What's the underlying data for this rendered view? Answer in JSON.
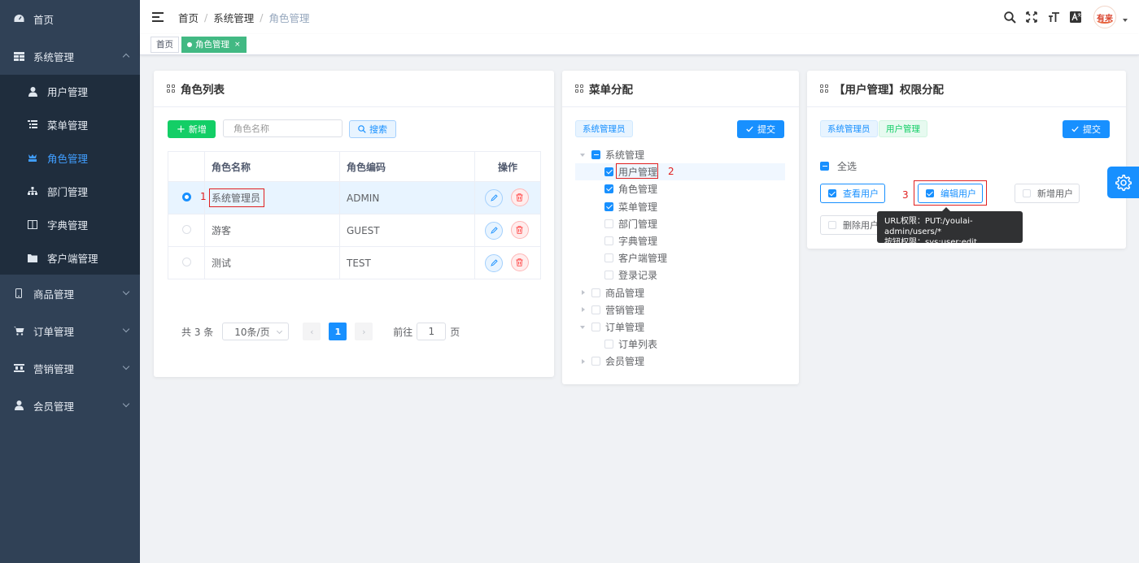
{
  "sidebar": {
    "items": [
      {
        "label": "首页",
        "icon": "dashboard-icon"
      },
      {
        "label": "系统管理",
        "icon": "grid-table-icon",
        "expanded": true,
        "children": [
          {
            "label": "用户管理",
            "icon": "user-icon"
          },
          {
            "label": "菜单管理",
            "icon": "tree-table-icon"
          },
          {
            "label": "角色管理",
            "icon": "role-icon",
            "active": true
          },
          {
            "label": "部门管理",
            "icon": "tree-icon"
          },
          {
            "label": "字典管理",
            "icon": "dict-icon"
          },
          {
            "label": "客户端管理",
            "icon": "client-icon"
          }
        ]
      },
      {
        "label": "商品管理",
        "icon": "phone-icon"
      },
      {
        "label": "订单管理",
        "icon": "cart-icon"
      },
      {
        "label": "营销管理",
        "icon": "marketing-icon"
      },
      {
        "label": "会员管理",
        "icon": "member-icon"
      }
    ]
  },
  "navbar": {
    "breadcrumb": [
      "首页",
      "系统管理",
      "角色管理"
    ],
    "sep": "/",
    "avatar_text": "有来"
  },
  "tags": {
    "home": "首页",
    "active": "角色管理",
    "close": "×"
  },
  "role_card": {
    "title": "角色列表",
    "add_label": "新增",
    "search_placeholder": "角色名称",
    "search_label": "搜索",
    "columns": [
      "角色名称",
      "角色编码",
      "操作"
    ],
    "rows": [
      {
        "name": "系统管理员",
        "code": "ADMIN",
        "selected": true
      },
      {
        "name": "游客",
        "code": "GUEST",
        "selected": false
      },
      {
        "name": "测试",
        "code": "TEST",
        "selected": false
      }
    ],
    "annotation": "1",
    "pagination": {
      "total": "共 3 条",
      "page_size": "10条/页",
      "prev": "‹",
      "current": "1",
      "next": "›",
      "goto_prefix": "前往",
      "goto_value": "1",
      "goto_suffix": "页"
    }
  },
  "menu_card": {
    "title": "菜单分配",
    "role_tag": "系统管理员",
    "submit_label": "提交",
    "annotation": "2",
    "tree": [
      {
        "label": "系统管理",
        "level": 0,
        "arrow": "down",
        "check": "half"
      },
      {
        "label": "用户管理",
        "level": 1,
        "arrow": "none",
        "check": "on",
        "highlight": true
      },
      {
        "label": "角色管理",
        "level": 1,
        "arrow": "none",
        "check": "on"
      },
      {
        "label": "菜单管理",
        "level": 1,
        "arrow": "none",
        "check": "on"
      },
      {
        "label": "部门管理",
        "level": 1,
        "arrow": "none",
        "check": "off"
      },
      {
        "label": "字典管理",
        "level": 1,
        "arrow": "none",
        "check": "off"
      },
      {
        "label": "客户端管理",
        "level": 1,
        "arrow": "none",
        "check": "off"
      },
      {
        "label": "登录记录",
        "level": 1,
        "arrow": "none",
        "check": "off"
      },
      {
        "label": "商品管理",
        "level": 0,
        "arrow": "right",
        "check": "off"
      },
      {
        "label": "营销管理",
        "level": 0,
        "arrow": "right",
        "check": "off"
      },
      {
        "label": "订单管理",
        "level": 0,
        "arrow": "down",
        "check": "off"
      },
      {
        "label": "订单列表",
        "level": 1,
        "arrow": "none",
        "check": "off"
      },
      {
        "label": "会员管理",
        "level": 0,
        "arrow": "right",
        "check": "off"
      }
    ]
  },
  "perm_card": {
    "title": "【用户管理】权限分配",
    "role_tag": "系统管理员",
    "menu_tag": "用户管理",
    "submit_label": "提交",
    "select_all": "全选",
    "annotation": "3",
    "perms": [
      {
        "label": "查看用户",
        "checked": true
      },
      {
        "label": "编辑用户",
        "checked": true
      },
      {
        "label": "新增用户",
        "checked": false
      },
      {
        "label": "删除用户",
        "checked": false
      }
    ],
    "tooltip": {
      "line1": "URL权限：PUT:/youlai-admin/users/*",
      "line2": "按钮权限：sys:user:edit"
    }
  },
  "colors": {
    "sidebar_bg": "#304156",
    "primary": "#1890ff",
    "success": "#13ce66",
    "danger": "#ff4949",
    "tag_active": "#42b983",
    "annotation_red": "#e02020"
  }
}
